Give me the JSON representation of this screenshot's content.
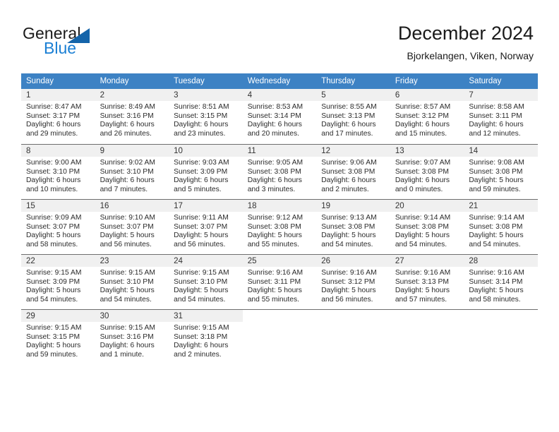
{
  "brand": {
    "name_part1": "General",
    "name_part2": "Blue",
    "triangle_color": "#1464AA",
    "blue_text_color": "#1A7FD4"
  },
  "header": {
    "title": "December 2024",
    "location": "Bjorkelangen, Viken, Norway"
  },
  "calendar": {
    "header_bg": "#3D82C4",
    "daynum_bg": "#F0F0F0",
    "weekdays": [
      "Sunday",
      "Monday",
      "Tuesday",
      "Wednesday",
      "Thursday",
      "Friday",
      "Saturday"
    ],
    "weeks": [
      [
        {
          "day": "1",
          "sunrise": "Sunrise: 8:47 AM",
          "sunset": "Sunset: 3:17 PM",
          "daylight_1": "Daylight: 6 hours",
          "daylight_2": "and 29 minutes."
        },
        {
          "day": "2",
          "sunrise": "Sunrise: 8:49 AM",
          "sunset": "Sunset: 3:16 PM",
          "daylight_1": "Daylight: 6 hours",
          "daylight_2": "and 26 minutes."
        },
        {
          "day": "3",
          "sunrise": "Sunrise: 8:51 AM",
          "sunset": "Sunset: 3:15 PM",
          "daylight_1": "Daylight: 6 hours",
          "daylight_2": "and 23 minutes."
        },
        {
          "day": "4",
          "sunrise": "Sunrise: 8:53 AM",
          "sunset": "Sunset: 3:14 PM",
          "daylight_1": "Daylight: 6 hours",
          "daylight_2": "and 20 minutes."
        },
        {
          "day": "5",
          "sunrise": "Sunrise: 8:55 AM",
          "sunset": "Sunset: 3:13 PM",
          "daylight_1": "Daylight: 6 hours",
          "daylight_2": "and 17 minutes."
        },
        {
          "day": "6",
          "sunrise": "Sunrise: 8:57 AM",
          "sunset": "Sunset: 3:12 PM",
          "daylight_1": "Daylight: 6 hours",
          "daylight_2": "and 15 minutes."
        },
        {
          "day": "7",
          "sunrise": "Sunrise: 8:58 AM",
          "sunset": "Sunset: 3:11 PM",
          "daylight_1": "Daylight: 6 hours",
          "daylight_2": "and 12 minutes."
        }
      ],
      [
        {
          "day": "8",
          "sunrise": "Sunrise: 9:00 AM",
          "sunset": "Sunset: 3:10 PM",
          "daylight_1": "Daylight: 6 hours",
          "daylight_2": "and 10 minutes."
        },
        {
          "day": "9",
          "sunrise": "Sunrise: 9:02 AM",
          "sunset": "Sunset: 3:10 PM",
          "daylight_1": "Daylight: 6 hours",
          "daylight_2": "and 7 minutes."
        },
        {
          "day": "10",
          "sunrise": "Sunrise: 9:03 AM",
          "sunset": "Sunset: 3:09 PM",
          "daylight_1": "Daylight: 6 hours",
          "daylight_2": "and 5 minutes."
        },
        {
          "day": "11",
          "sunrise": "Sunrise: 9:05 AM",
          "sunset": "Sunset: 3:08 PM",
          "daylight_1": "Daylight: 6 hours",
          "daylight_2": "and 3 minutes."
        },
        {
          "day": "12",
          "sunrise": "Sunrise: 9:06 AM",
          "sunset": "Sunset: 3:08 PM",
          "daylight_1": "Daylight: 6 hours",
          "daylight_2": "and 2 minutes."
        },
        {
          "day": "13",
          "sunrise": "Sunrise: 9:07 AM",
          "sunset": "Sunset: 3:08 PM",
          "daylight_1": "Daylight: 6 hours",
          "daylight_2": "and 0 minutes."
        },
        {
          "day": "14",
          "sunrise": "Sunrise: 9:08 AM",
          "sunset": "Sunset: 3:08 PM",
          "daylight_1": "Daylight: 5 hours",
          "daylight_2": "and 59 minutes."
        }
      ],
      [
        {
          "day": "15",
          "sunrise": "Sunrise: 9:09 AM",
          "sunset": "Sunset: 3:07 PM",
          "daylight_1": "Daylight: 5 hours",
          "daylight_2": "and 58 minutes."
        },
        {
          "day": "16",
          "sunrise": "Sunrise: 9:10 AM",
          "sunset": "Sunset: 3:07 PM",
          "daylight_1": "Daylight: 5 hours",
          "daylight_2": "and 56 minutes."
        },
        {
          "day": "17",
          "sunrise": "Sunrise: 9:11 AM",
          "sunset": "Sunset: 3:07 PM",
          "daylight_1": "Daylight: 5 hours",
          "daylight_2": "and 56 minutes."
        },
        {
          "day": "18",
          "sunrise": "Sunrise: 9:12 AM",
          "sunset": "Sunset: 3:08 PM",
          "daylight_1": "Daylight: 5 hours",
          "daylight_2": "and 55 minutes."
        },
        {
          "day": "19",
          "sunrise": "Sunrise: 9:13 AM",
          "sunset": "Sunset: 3:08 PM",
          "daylight_1": "Daylight: 5 hours",
          "daylight_2": "and 54 minutes."
        },
        {
          "day": "20",
          "sunrise": "Sunrise: 9:14 AM",
          "sunset": "Sunset: 3:08 PM",
          "daylight_1": "Daylight: 5 hours",
          "daylight_2": "and 54 minutes."
        },
        {
          "day": "21",
          "sunrise": "Sunrise: 9:14 AM",
          "sunset": "Sunset: 3:08 PM",
          "daylight_1": "Daylight: 5 hours",
          "daylight_2": "and 54 minutes."
        }
      ],
      [
        {
          "day": "22",
          "sunrise": "Sunrise: 9:15 AM",
          "sunset": "Sunset: 3:09 PM",
          "daylight_1": "Daylight: 5 hours",
          "daylight_2": "and 54 minutes."
        },
        {
          "day": "23",
          "sunrise": "Sunrise: 9:15 AM",
          "sunset": "Sunset: 3:10 PM",
          "daylight_1": "Daylight: 5 hours",
          "daylight_2": "and 54 minutes."
        },
        {
          "day": "24",
          "sunrise": "Sunrise: 9:15 AM",
          "sunset": "Sunset: 3:10 PM",
          "daylight_1": "Daylight: 5 hours",
          "daylight_2": "and 54 minutes."
        },
        {
          "day": "25",
          "sunrise": "Sunrise: 9:16 AM",
          "sunset": "Sunset: 3:11 PM",
          "daylight_1": "Daylight: 5 hours",
          "daylight_2": "and 55 minutes."
        },
        {
          "day": "26",
          "sunrise": "Sunrise: 9:16 AM",
          "sunset": "Sunset: 3:12 PM",
          "daylight_1": "Daylight: 5 hours",
          "daylight_2": "and 56 minutes."
        },
        {
          "day": "27",
          "sunrise": "Sunrise: 9:16 AM",
          "sunset": "Sunset: 3:13 PM",
          "daylight_1": "Daylight: 5 hours",
          "daylight_2": "and 57 minutes."
        },
        {
          "day": "28",
          "sunrise": "Sunrise: 9:16 AM",
          "sunset": "Sunset: 3:14 PM",
          "daylight_1": "Daylight: 5 hours",
          "daylight_2": "and 58 minutes."
        }
      ],
      [
        {
          "day": "29",
          "sunrise": "Sunrise: 9:15 AM",
          "sunset": "Sunset: 3:15 PM",
          "daylight_1": "Daylight: 5 hours",
          "daylight_2": "and 59 minutes."
        },
        {
          "day": "30",
          "sunrise": "Sunrise: 9:15 AM",
          "sunset": "Sunset: 3:16 PM",
          "daylight_1": "Daylight: 6 hours",
          "daylight_2": "and 1 minute."
        },
        {
          "day": "31",
          "sunrise": "Sunrise: 9:15 AM",
          "sunset": "Sunset: 3:18 PM",
          "daylight_1": "Daylight: 6 hours",
          "daylight_2": "and 2 minutes."
        },
        {
          "day": "",
          "sunrise": "",
          "sunset": "",
          "daylight_1": "",
          "daylight_2": ""
        },
        {
          "day": "",
          "sunrise": "",
          "sunset": "",
          "daylight_1": "",
          "daylight_2": ""
        },
        {
          "day": "",
          "sunrise": "",
          "sunset": "",
          "daylight_1": "",
          "daylight_2": ""
        },
        {
          "day": "",
          "sunrise": "",
          "sunset": "",
          "daylight_1": "",
          "daylight_2": ""
        }
      ]
    ]
  }
}
